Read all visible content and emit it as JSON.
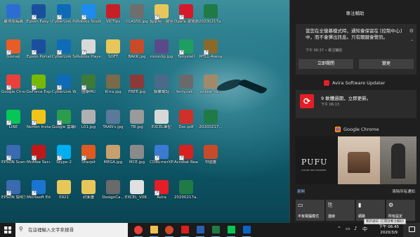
{
  "desktop": {
    "icons": [
      {
        "label": "贏得原稿碼",
        "color": "#2d6dd2",
        "col": 0,
        "row": 0,
        "shortcut": false
      },
      {
        "label": "Epson Easy Photo Print",
        "color": "#1a4f9e",
        "col": 1,
        "row": 0,
        "shortcut": true
      },
      {
        "label": "CyberLink PowerDir...",
        "color": "#0e6bb8",
        "col": 2,
        "row": 0,
        "shortcut": true
      },
      {
        "label": "Roblox Studio",
        "color": "#1c8cf0",
        "col": 3,
        "row": 0,
        "shortcut": true
      },
      {
        "label": "VICTips",
        "color": "#c61f25",
        "col": 4,
        "row": 0,
        "shortcut": false
      },
      {
        "label": "CLASSS.jpg",
        "color": "#6e6e6e",
        "col": 5,
        "row": 0,
        "shortcut": false
      },
      {
        "label": "錯學用 - 捷徑",
        "color": "#e8c75a",
        "col": 6,
        "row": 0,
        "shortcut": true
      },
      {
        "label": "Opera 瀏覽器",
        "color": "#d6182b",
        "col": 7,
        "row": 0,
        "shortcut": true
      },
      {
        "label": "20200217a...",
        "color": "#1f7a46",
        "col": 8,
        "row": 0,
        "shortcut": false
      },
      {
        "label": "Gomaji",
        "color": "#e85d27",
        "col": 0,
        "row": 1,
        "shortcut": true
      },
      {
        "label": "Epson Portal",
        "color": "#1a4f9e",
        "col": 1,
        "row": 1,
        "shortcut": true
      },
      {
        "label": "CyberLink Screen Re...",
        "color": "#0e6bb8",
        "col": 2,
        "row": 1,
        "shortcut": true
      },
      {
        "label": "Roblox Player",
        "color": "#d9d9d9",
        "col": 3,
        "row": 1,
        "shortcut": true
      },
      {
        "label": "SOFT",
        "color": "#e8c75a",
        "col": 4,
        "row": 1,
        "shortcut": false
      },
      {
        "label": "BAKK.jpg",
        "color": "#c94a2b",
        "col": 5,
        "row": 1,
        "shortcut": false
      },
      {
        "label": "moonlip.jpg",
        "color": "#5a4a8a",
        "col": 6,
        "row": 1,
        "shortcut": false
      },
      {
        "label": "Tenystell",
        "color": "#1f9e62",
        "col": 7,
        "row": 1,
        "shortcut": true
      },
      {
        "label": "MTLL-Arena",
        "color": "#8a6a2a",
        "col": 8,
        "row": 1,
        "shortcut": true
      },
      {
        "label": "Google Chrome",
        "color": "#e9413a",
        "col": 0,
        "row": 2,
        "shortcut": true
      },
      {
        "label": "GeForce Experience",
        "color": "#76b900",
        "col": 1,
        "row": 2,
        "shortcut": true
      },
      {
        "label": "CyberLink WaveEdit...",
        "color": "#0e6bb8",
        "col": 2,
        "row": 2,
        "shortcut": true
      },
      {
        "label": "國泰MU",
        "color": "#3b7a3a",
        "col": 3,
        "row": 2,
        "shortcut": true
      },
      {
        "label": "Kirra.jpg",
        "color": "#7a6a4a",
        "col": 4,
        "row": 2,
        "shortcut": false
      },
      {
        "label": "FREE.jpg",
        "color": "#8b3a3a",
        "col": 5,
        "row": 2,
        "shortcut": false
      },
      {
        "label": "聯繫電話",
        "color": "#4a6a8a",
        "col": 6,
        "row": 2,
        "shortcut": false
      },
      {
        "label": "ferry.cat...",
        "color": "#6a6a6a",
        "col": 7,
        "row": 2,
        "shortcut": false
      },
      {
        "label": "online_to...",
        "color": "#a08a6a",
        "col": 8,
        "row": 2,
        "shortcut": false
      },
      {
        "label": "LINE",
        "color": "#06c755",
        "col": 0,
        "row": 3,
        "shortcut": true
      },
      {
        "label": "Norton Installation",
        "color": "#f0c419",
        "col": 1,
        "row": 3,
        "shortcut": true
      },
      {
        "label": "Google 雲端硬碟",
        "color": "#2a9d4a",
        "col": 2,
        "row": 3,
        "shortcut": true
      },
      {
        "label": "L01.jpg",
        "color": "#b0b0b0",
        "col": 3,
        "row": 3,
        "shortcut": false
      },
      {
        "label": "TAAN's.jpg",
        "color": "#5a7a9a",
        "col": 4,
        "row": 3,
        "shortcut": false
      },
      {
        "label": "TB.jpg",
        "color": "#9a9a9a",
        "col": 5,
        "row": 3,
        "shortcut": false
      },
      {
        "label": "EXCEL筆記",
        "color": "#d8d8d8",
        "col": 6,
        "row": 3,
        "shortcut": false
      },
      {
        "label": "Doc.pdf",
        "color": "#d0302a",
        "col": 7,
        "row": 3,
        "shortcut": false
      },
      {
        "label": "20200217...",
        "color": "#1f7a46",
        "col": 8,
        "row": 3,
        "shortcut": false
      },
      {
        "label": "EPSON Scan",
        "color": "#3a6ab0",
        "col": 0,
        "row": 4,
        "shortcut": true
      },
      {
        "label": "McAfee Security...",
        "color": "#c01818",
        "col": 1,
        "row": 4,
        "shortcut": true
      },
      {
        "label": "Skype-2",
        "color": "#00aff0",
        "col": 2,
        "row": 4,
        "shortcut": true
      },
      {
        "label": "Sharpit",
        "color": "#e05a20",
        "col": 3,
        "row": 4,
        "shortcut": true
      },
      {
        "label": "MEGA.jpg",
        "color": "#c8a070",
        "col": 4,
        "row": 4,
        "shortcut": false
      },
      {
        "label": "MCE.jpg",
        "color": "#8a8a8a",
        "col": 5,
        "row": 4,
        "shortcut": false
      },
      {
        "label": "CDBurnerXP",
        "color": "#3a7ad0",
        "col": 6,
        "row": 4,
        "shortcut": true
      },
      {
        "label": "Acrobat Reader DC",
        "color": "#d8201e",
        "col": 7,
        "row": 4,
        "shortcut": true
      },
      {
        "label": "中國畫",
        "color": "#c84a2a",
        "col": 8,
        "row": 4,
        "shortcut": false
      },
      {
        "label": "EPSON 說明文件",
        "color": "#3a6ab0",
        "col": 0,
        "row": 5,
        "shortcut": true
      },
      {
        "label": "Microsoft Edge",
        "color": "#1a75d0",
        "col": 1,
        "row": 5,
        "shortcut": true
      },
      {
        "label": "0921",
        "color": "#e8c75a",
        "col": 2,
        "row": 5,
        "shortcut": false
      },
      {
        "label": "封面畫",
        "color": "#e8c75a",
        "col": 3,
        "row": 5,
        "shortcut": false
      },
      {
        "label": "DesignCa...",
        "color": "#6a6a6a",
        "col": 4,
        "row": 5,
        "shortcut": false
      },
      {
        "label": "EXCEL_V08...",
        "color": "#e0e0e0",
        "col": 5,
        "row": 5,
        "shortcut": false
      },
      {
        "label": "Avira",
        "color": "#e41e26",
        "col": 6,
        "row": 5,
        "shortcut": true
      },
      {
        "label": "20200217a...",
        "color": "#1f7a46",
        "col": 7,
        "row": 5,
        "shortcut": false
      }
    ]
  },
  "action_center": {
    "header": "專注輔助",
    "focus": {
      "message": "當您在全螢幕模式時，通知會保留在 [控制中心] 中，而不會彈出訊息。只有關鍵會警訊。",
      "time": "下午 06:37 • 專注輔助",
      "btn_disable": "立即關閉",
      "btn_change": "變更"
    },
    "avira": {
      "app_name": "Avira Software Updater",
      "title": "9 軟體過期，立即更新。",
      "time": "下午 06:13"
    },
    "chrome": {
      "app_name": "Google Chrome",
      "brand": "PUFU",
      "brand_sub": "UTILISE AND TRANSFER"
    },
    "bottom_left": "展開",
    "bottom_right": "清除所有通知",
    "quick_actions": [
      {
        "label": "平板電腦模式",
        "icon": "tablet-icon"
      },
      {
        "label": "連線",
        "icon": "connect-icon"
      },
      {
        "label": "網路",
        "icon": "network-icon"
      },
      {
        "label": "所有設定",
        "icon": "settings-icon"
      }
    ],
    "tooltip": "無新通知 (已開啟專注輔助)"
  },
  "taskbar": {
    "search_placeholder": "在這裡輸入文字來搜尋",
    "apps": [
      {
        "name": "chrome",
        "color": "#e9413a",
        "shape": "dot"
      },
      {
        "name": "file-explorer",
        "color": "#f0c050",
        "shape": "sq"
      },
      {
        "name": "powerpoint",
        "color": "#d04a2a",
        "shape": "dot"
      },
      {
        "name": "acrobat",
        "color": "#d8201e",
        "shape": "sq"
      },
      {
        "name": "word",
        "color": "#2b5fb0",
        "shape": "sq"
      },
      {
        "name": "excel",
        "color": "#1f7a46",
        "shape": "sq"
      },
      {
        "name": "line",
        "color": "#06c755",
        "shape": "sq"
      },
      {
        "name": "outlook",
        "color": "#0a64c8",
        "shape": "sq"
      }
    ],
    "clock_time": "下午 06:45",
    "clock_date": "2020/3/9",
    "ime": "中"
  }
}
